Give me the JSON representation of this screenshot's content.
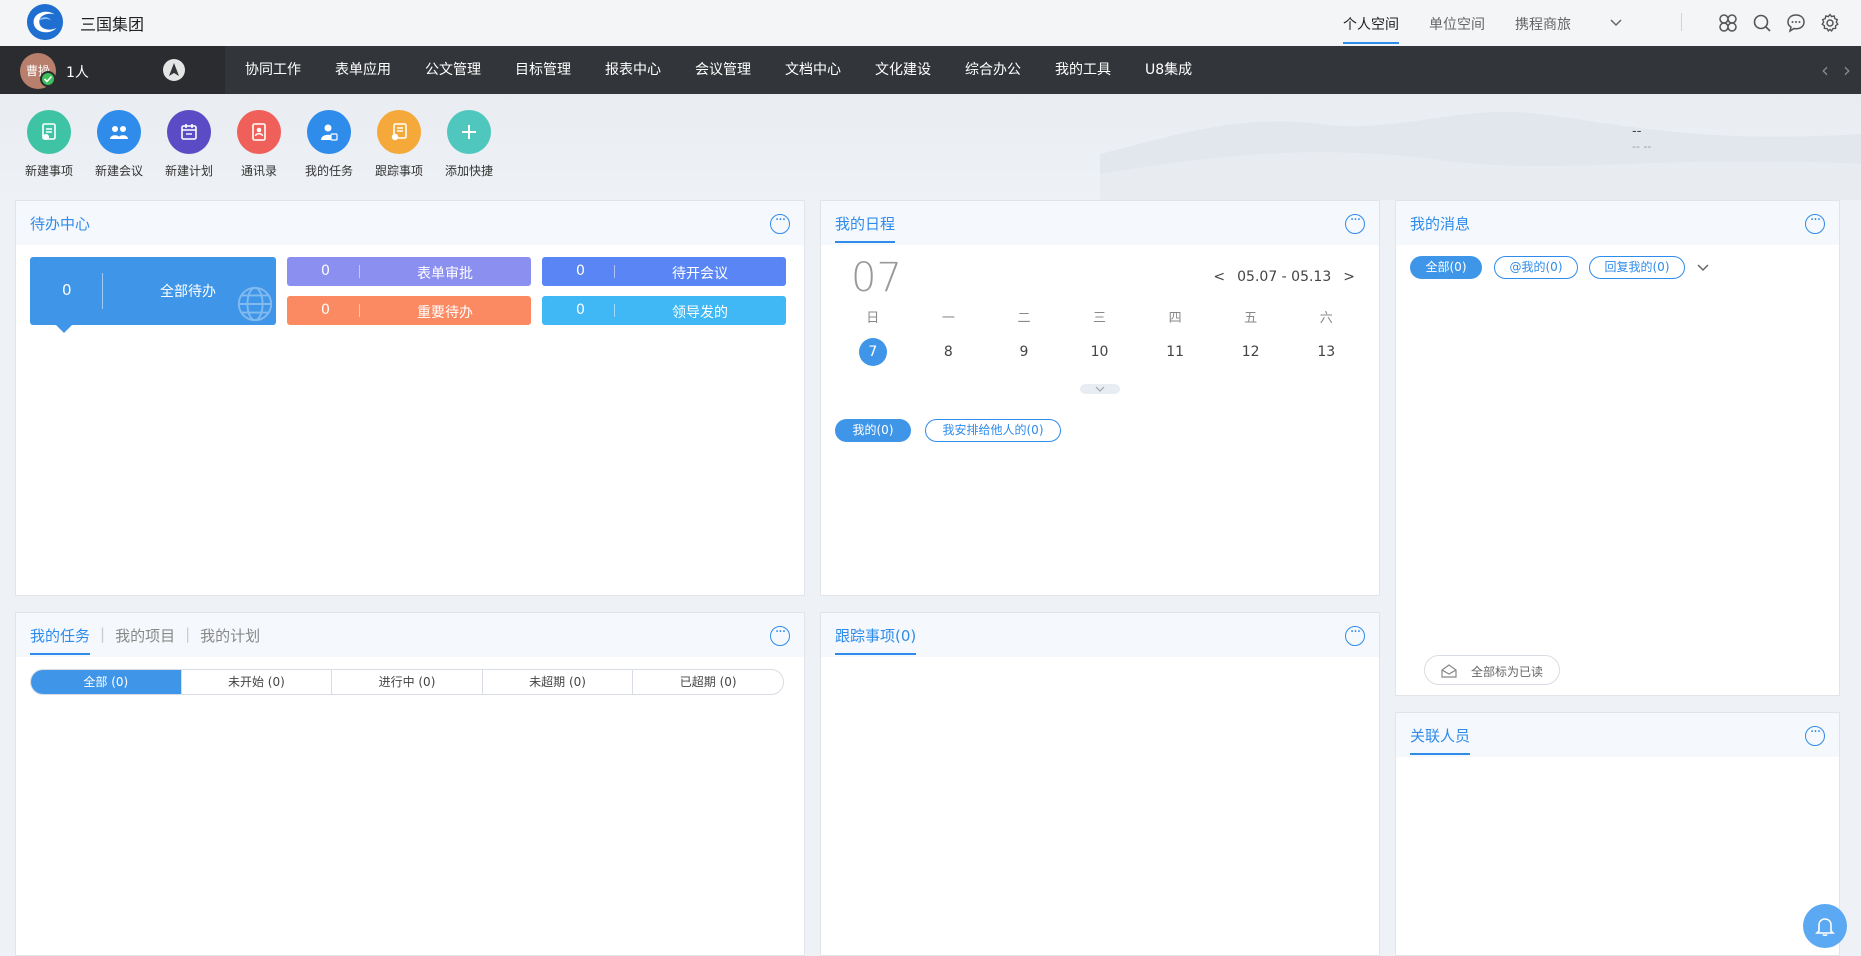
{
  "header": {
    "brand": "三国集团",
    "space_tabs": [
      {
        "label": "个人空间",
        "active": true
      },
      {
        "label": "单位空间",
        "active": false
      },
      {
        "label": "携程商旅",
        "active": false
      }
    ],
    "icons": [
      "apps-grid-icon",
      "search-icon",
      "chat-icon",
      "gear-icon"
    ]
  },
  "nav": {
    "avatar_text": "曹操",
    "user_count": "1人",
    "items": [
      "协同工作",
      "表单应用",
      "公文管理",
      "目标管理",
      "报表中心",
      "会议管理",
      "文档中心",
      "文化建设",
      "综合办公",
      "我的工具",
      "U8集成"
    ],
    "prev": "‹",
    "next": "›"
  },
  "shortcuts": [
    {
      "label": "新建事项",
      "color": "#3ec3a4",
      "icon": "new-item-icon"
    },
    {
      "label": "新建会议",
      "color": "#2f8ceb",
      "icon": "meeting-icon"
    },
    {
      "label": "新建计划",
      "color": "#5b4bc4",
      "icon": "calendar-icon"
    },
    {
      "label": "通讯录",
      "color": "#f0605a",
      "icon": "contacts-icon"
    },
    {
      "label": "我的任务",
      "color": "#2f8ceb",
      "icon": "task-icon"
    },
    {
      "label": "跟踪事项",
      "color": "#f5a93b",
      "icon": "track-icon"
    },
    {
      "label": "添加快捷",
      "color": "#4fc7be",
      "icon": "plus-icon"
    }
  ],
  "weather": {
    "line1": "--",
    "line2": "-- --"
  },
  "todo": {
    "title": "待办中心",
    "main": {
      "count": "0",
      "label": "全部待办"
    },
    "boxes": [
      {
        "count": "0",
        "label": "表单审批",
        "color": "#8b8ff0"
      },
      {
        "count": "0",
        "label": "待开会议",
        "color": "#5a86f5"
      },
      {
        "count": "0",
        "label": "重要待办",
        "color": "#fb8a63"
      },
      {
        "count": "0",
        "label": "领导发的",
        "color": "#3fb8f5"
      }
    ]
  },
  "schedule": {
    "title": "我的日程",
    "month_day": "07",
    "range_prev": "<",
    "range": "05.07 - 05.13",
    "range_next": ">",
    "weekdays": [
      "日",
      "一",
      "二",
      "三",
      "四",
      "五",
      "六"
    ],
    "days": [
      "7",
      "8",
      "9",
      "10",
      "11",
      "12",
      "13"
    ],
    "today": "7",
    "filters": [
      {
        "label": "我的(0)",
        "active": true
      },
      {
        "label": "我安排给他人的(0)",
        "active": false
      }
    ]
  },
  "messages": {
    "title": "我的消息",
    "filters": [
      {
        "label": "全部(0)",
        "active": true
      },
      {
        "label": "@我的(0)",
        "active": false
      },
      {
        "label": "回复我的(0)",
        "active": false
      }
    ],
    "mark_read": "全部标为已读"
  },
  "tasks": {
    "tabs": [
      {
        "label": "我的任务",
        "active": true
      },
      {
        "label": "我的项目",
        "active": false
      },
      {
        "label": "我的计划",
        "active": false
      }
    ],
    "segments": [
      {
        "label": "全部 (0)",
        "active": true
      },
      {
        "label": "未开始 (0)",
        "active": false
      },
      {
        "label": "进行中 (0)",
        "active": false
      },
      {
        "label": "未超期 (0)",
        "active": false
      },
      {
        "label": "已超期 (0)",
        "active": false
      }
    ]
  },
  "tracking": {
    "title": "跟踪事项(0)"
  },
  "related": {
    "title": "关联人员"
  }
}
